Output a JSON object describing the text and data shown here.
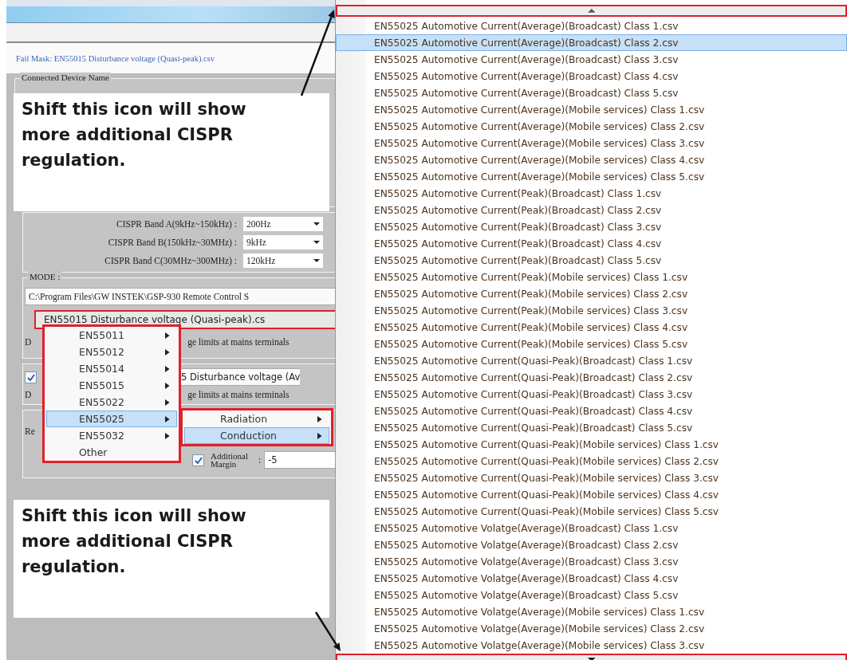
{
  "fail_mask_link": "Fail Mask: EN55015 Disturbance voltage (Quasi-peak).csv",
  "device_group": {
    "legend": "Connected Device Name"
  },
  "callouts": [
    {
      "text": "Shift this icon will show more additional CISPR regulation."
    },
    {
      "text": "Shift this icon will show more additional CISPR regulation."
    }
  ],
  "bands": [
    {
      "label": "CISPR Band A(9kHz~150kHz) :",
      "value": "200Hz"
    },
    {
      "label": "CISPR Band B(150kHz~30MHz) :",
      "value": "9kHz"
    },
    {
      "label": "CISPR Band C(30MHz~300MHz) :",
      "value": "120kHz"
    }
  ],
  "mode": {
    "legend": "MODE :",
    "path": "C:\\Program Files\\GW INSTEK\\GSP-930 Remote Control S",
    "selected_file": "EN55015 Disturbance voltage (Quasi-peak).cs",
    "description_start": "D",
    "description_end": "ge limits at mains terminals"
  },
  "second_mask": {
    "checked": true,
    "file": "5 Disturbance voltage (Av",
    "description_start": "D",
    "description_end": "ge limits at mains terminals"
  },
  "margin_group": {
    "label_start": "Re",
    "additional_margin": {
      "checked": true,
      "label": "Additional Margin",
      "separator": ":",
      "value": "-5"
    }
  },
  "standards_menu": [
    {
      "label": "EN55011",
      "submenu": true,
      "selected": false
    },
    {
      "label": "EN55012",
      "submenu": true,
      "selected": false
    },
    {
      "label": "EN55014",
      "submenu": true,
      "selected": false
    },
    {
      "label": "EN55015",
      "submenu": true,
      "selected": false
    },
    {
      "label": "EN55022",
      "submenu": true,
      "selected": false
    },
    {
      "label": "EN55025",
      "submenu": true,
      "selected": true
    },
    {
      "label": "EN55032",
      "submenu": true,
      "selected": false
    },
    {
      "label": "Other",
      "submenu": false,
      "selected": false
    }
  ],
  "submenu": [
    {
      "label": "Radiation",
      "submenu": true,
      "selected": false
    },
    {
      "label": "Conduction",
      "submenu": true,
      "selected": true
    }
  ],
  "file_menu": [
    {
      "label": "EN55025 Automotive Current(Average)(Broadcast) Class 1.csv",
      "selected": false
    },
    {
      "label": "EN55025 Automotive Current(Average)(Broadcast) Class 2.csv",
      "selected": true
    },
    {
      "label": "EN55025 Automotive Current(Average)(Broadcast) Class 3.csv",
      "selected": false
    },
    {
      "label": "EN55025 Automotive Current(Average)(Broadcast) Class 4.csv",
      "selected": false
    },
    {
      "label": "EN55025 Automotive Current(Average)(Broadcast) Class 5.csv",
      "selected": false
    },
    {
      "label": "EN55025 Automotive Current(Average)(Mobile services) Class 1.csv",
      "selected": false
    },
    {
      "label": "EN55025 Automotive Current(Average)(Mobile services) Class 2.csv",
      "selected": false
    },
    {
      "label": "EN55025 Automotive Current(Average)(Mobile services) Class 3.csv",
      "selected": false
    },
    {
      "label": "EN55025 Automotive Current(Average)(Mobile services) Class 4.csv",
      "selected": false
    },
    {
      "label": "EN55025 Automotive Current(Average)(Mobile services) Class 5.csv",
      "selected": false
    },
    {
      "label": "EN55025 Automotive Current(Peak)(Broadcast) Class 1.csv",
      "selected": false
    },
    {
      "label": "EN55025 Automotive Current(Peak)(Broadcast) Class 2.csv",
      "selected": false
    },
    {
      "label": "EN55025 Automotive Current(Peak)(Broadcast) Class 3.csv",
      "selected": false
    },
    {
      "label": "EN55025 Automotive Current(Peak)(Broadcast) Class 4.csv",
      "selected": false
    },
    {
      "label": "EN55025 Automotive Current(Peak)(Broadcast) Class 5.csv",
      "selected": false
    },
    {
      "label": "EN55025 Automotive Current(Peak)(Mobile services) Class 1.csv",
      "selected": false
    },
    {
      "label": "EN55025 Automotive Current(Peak)(Mobile services) Class 2.csv",
      "selected": false
    },
    {
      "label": "EN55025 Automotive Current(Peak)(Mobile services) Class 3.csv",
      "selected": false
    },
    {
      "label": "EN55025 Automotive Current(Peak)(Mobile services) Class 4.csv",
      "selected": false
    },
    {
      "label": "EN55025 Automotive Current(Peak)(Mobile services) Class 5.csv",
      "selected": false
    },
    {
      "label": "EN55025 Automotive Current(Quasi-Peak)(Broadcast) Class 1.csv",
      "selected": false
    },
    {
      "label": "EN55025 Automotive Current(Quasi-Peak)(Broadcast) Class 2.csv",
      "selected": false
    },
    {
      "label": "EN55025 Automotive Current(Quasi-Peak)(Broadcast) Class 3.csv",
      "selected": false
    },
    {
      "label": "EN55025 Automotive Current(Quasi-Peak)(Broadcast) Class 4.csv",
      "selected": false
    },
    {
      "label": "EN55025 Automotive Current(Quasi-Peak)(Broadcast) Class 5.csv",
      "selected": false
    },
    {
      "label": "EN55025 Automotive Current(Quasi-Peak)(Mobile services) Class 1.csv",
      "selected": false
    },
    {
      "label": "EN55025 Automotive Current(Quasi-Peak)(Mobile services) Class 2.csv",
      "selected": false
    },
    {
      "label": "EN55025 Automotive Current(Quasi-Peak)(Mobile services) Class 3.csv",
      "selected": false
    },
    {
      "label": "EN55025 Automotive Current(Quasi-Peak)(Mobile services) Class 4.csv",
      "selected": false
    },
    {
      "label": "EN55025 Automotive Current(Quasi-Peak)(Mobile services) Class 5.csv",
      "selected": false
    },
    {
      "label": "EN55025 Automotive Volatge(Average)(Broadcast) Class 1.csv",
      "selected": false
    },
    {
      "label": "EN55025 Automotive Volatge(Average)(Broadcast) Class 2.csv",
      "selected": false
    },
    {
      "label": "EN55025 Automotive Volatge(Average)(Broadcast) Class 3.csv",
      "selected": false
    },
    {
      "label": "EN55025 Automotive Volatge(Average)(Broadcast) Class 4.csv",
      "selected": false
    },
    {
      "label": "EN55025 Automotive Volatge(Average)(Broadcast) Class 5.csv",
      "selected": false
    },
    {
      "label": "EN55025 Automotive Volatge(Average)(Mobile services) Class 1.csv",
      "selected": false
    },
    {
      "label": "EN55025 Automotive Volatge(Average)(Mobile services) Class 2.csv",
      "selected": false
    },
    {
      "label": "EN55025 Automotive Volatge(Average)(Mobile services) Class 3.csv",
      "selected": false
    }
  ]
}
